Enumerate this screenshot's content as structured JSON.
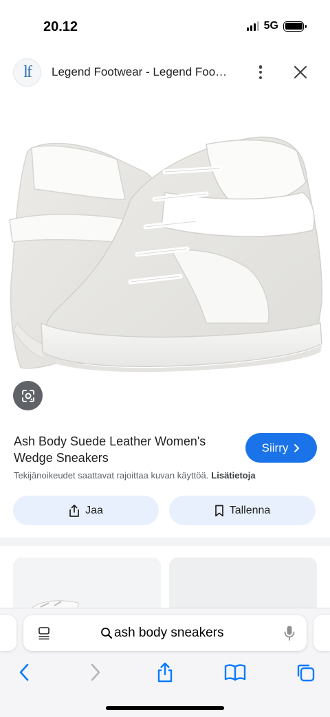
{
  "status_bar": {
    "time": "20.12",
    "network": "5G"
  },
  "header": {
    "logo_text": "lf",
    "title": "Legend Footwear - Legend Foo…"
  },
  "product": {
    "title": "Ash Body Suede Leather Women's Wedge Sneakers",
    "visit_label": "Siirry",
    "copyright_text": "Tekijänoikeudet saattavat rajoittaa kuvan käyttöä.",
    "copyright_link": "Lisätietoja"
  },
  "actions": {
    "share_label": "Jaa",
    "save_label": "Tallenna"
  },
  "browser": {
    "address_query": "ash body sneakers"
  },
  "colors": {
    "accent": "#1a73e8",
    "pill_bg": "#e8f0fe",
    "lens_bg": "#5f6368",
    "ios_blue": "#0a7aff"
  },
  "icons": [
    "signal-icon",
    "battery-icon",
    "more-vert-icon",
    "close-icon",
    "google-lens-icon",
    "chevron-right-icon",
    "share-icon",
    "bookmark-icon",
    "reader-icon",
    "search-icon",
    "mic-icon",
    "back-icon",
    "forward-icon",
    "ios-share-icon",
    "bookmarks-icon",
    "tabs-icon"
  ]
}
